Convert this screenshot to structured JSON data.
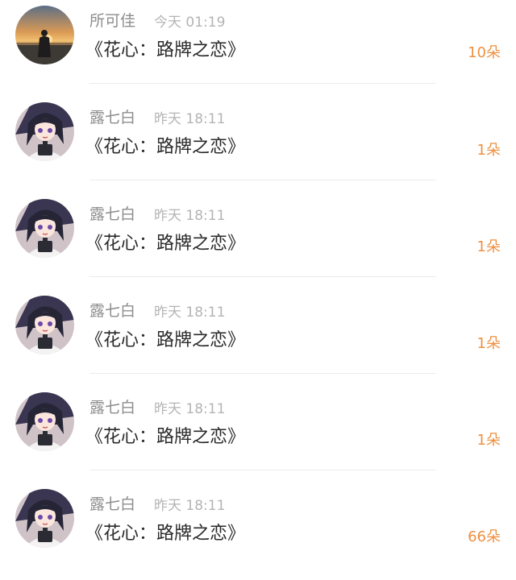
{
  "comments": [
    {
      "user": "所可佳",
      "time": "今天 01:19",
      "title": "《花心：路牌之恋》",
      "gift": "10朵",
      "avatar": "sunset-avatar"
    },
    {
      "user": "露七白",
      "time": "昨天 18:11",
      "title": "《花心：路牌之恋》",
      "gift": "1朵",
      "avatar": "anime-girl-avatar"
    },
    {
      "user": "露七白",
      "time": "昨天 18:11",
      "title": "《花心：路牌之恋》",
      "gift": "1朵",
      "avatar": "anime-girl-avatar"
    },
    {
      "user": "露七白",
      "time": "昨天 18:11",
      "title": "《花心：路牌之恋》",
      "gift": "1朵",
      "avatar": "anime-girl-avatar"
    },
    {
      "user": "露七白",
      "time": "昨天 18:11",
      "title": "《花心：路牌之恋》",
      "gift": "1朵",
      "avatar": "anime-girl-avatar"
    },
    {
      "user": "露七白",
      "time": "昨天 18:11",
      "title": "《花心：路牌之恋》",
      "gift": "66朵",
      "avatar": "anime-girl-avatar"
    }
  ],
  "colors": {
    "username": "#8d8d8d",
    "timestamp": "#b4b4b4",
    "title": "#2a2a2a",
    "gift_count": "#ee9040"
  }
}
